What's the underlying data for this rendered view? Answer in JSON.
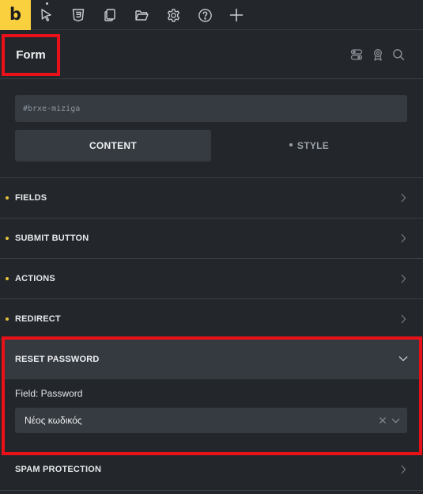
{
  "app": {
    "logo_letter": "b"
  },
  "toolbar": {
    "tools": [
      "select-cursor-icon",
      "css3-icon",
      "pages-icon",
      "folder-icon",
      "settings-icon",
      "help-icon",
      "add-icon"
    ]
  },
  "header": {
    "title": "Form",
    "actions": [
      "toggle-icon",
      "badge-icon",
      "search-icon"
    ]
  },
  "css_id": {
    "placeholder": "#brxe-miziga"
  },
  "tabs": {
    "content_label": "CONTENT",
    "style_label": "STYLE",
    "active": "content"
  },
  "groups": [
    {
      "label": "FIELDS",
      "has_settings": true
    },
    {
      "label": "SUBMIT BUTTON",
      "has_settings": true
    },
    {
      "label": "ACTIONS",
      "has_settings": true
    },
    {
      "label": "REDIRECT",
      "has_settings": true
    },
    {
      "label": "RESET PASSWORD",
      "expanded": true
    },
    {
      "label": "SPAM PROTECTION",
      "has_settings": false
    }
  ],
  "reset_password": {
    "field_label": "Field: Password",
    "selected_value": "Νέος κωδικός"
  },
  "colors": {
    "accent": "#fbd03e",
    "highlight": "#e8111a",
    "panel_bg": "#23272b",
    "input_bg": "#363b42"
  }
}
